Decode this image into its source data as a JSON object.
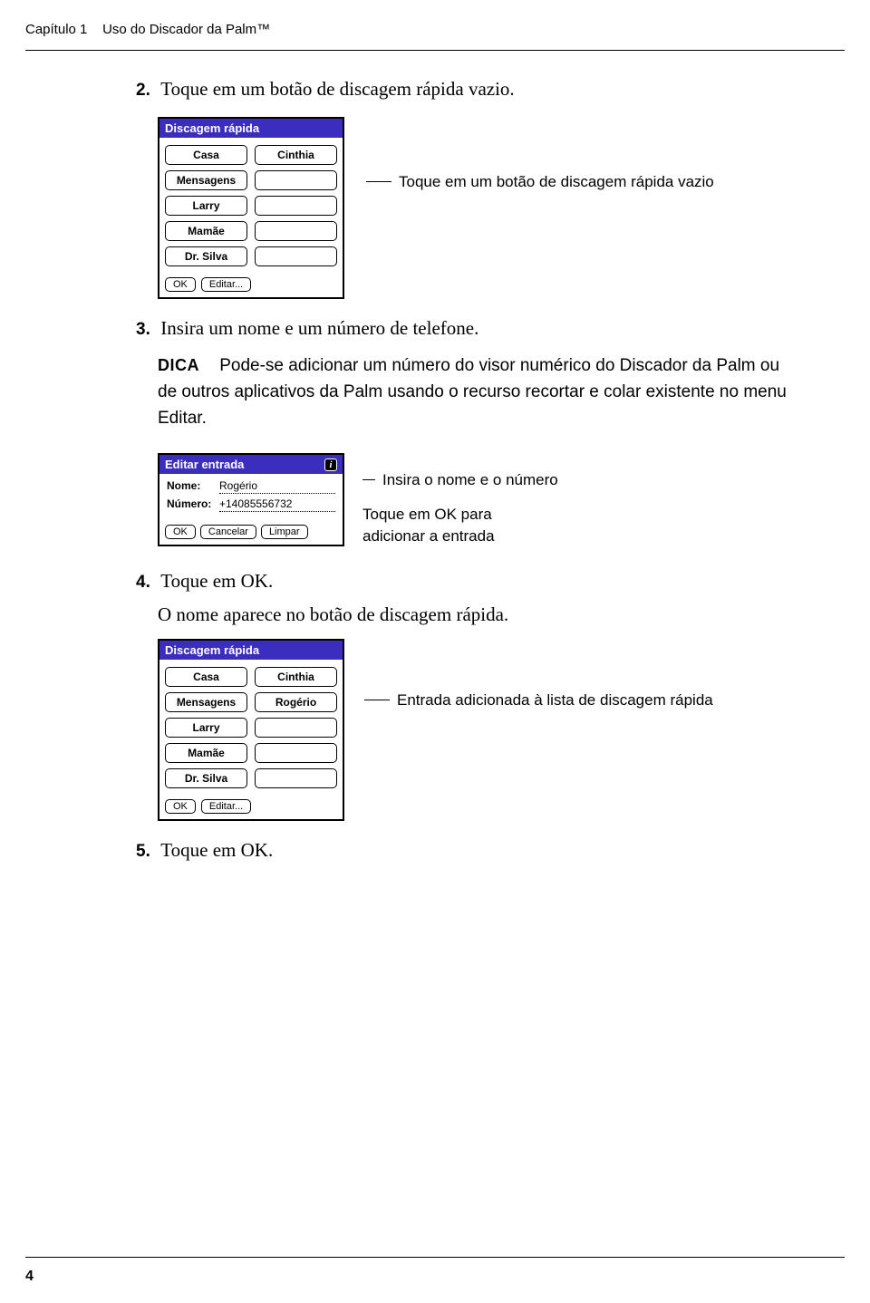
{
  "header": {
    "chapter_label": "Capítulo 1",
    "chapter_title": "Uso do Discador da Palm™"
  },
  "steps": {
    "s2_num": "2.",
    "s2_text": "Toque em um botão de discagem rápida vazio.",
    "s3_num": "3.",
    "s3_text": "Insira um nome e um número de telefone.",
    "s4_num": "4.",
    "s4_text": "Toque em OK.",
    "s4_body": "O nome aparece no botão de discagem rápida.",
    "s5_num": "5.",
    "s5_text": "Toque em OK."
  },
  "dica": {
    "label": "DICA",
    "text": "Pode-se adicionar um número do visor numérico do Discador da Palm ou de outros aplicativos da Palm usando o recurso recortar e colar existente no menu Editar."
  },
  "annotations": {
    "empty_button": "Toque em um botão de discagem rápida vazio",
    "insert_name_number": "Insira o nome e o número",
    "tap_ok_line1": "Toque em OK para",
    "tap_ok_line2": "adicionar a entrada",
    "entry_added": "Entrada adicionada à lista de discagem rápida"
  },
  "palm": {
    "speed_dial_title": "Discagem rápida",
    "ok": "OK",
    "edit": "Editar...",
    "buttons1": [
      "Casa",
      "Cinthia",
      "Mensagens",
      "",
      "Larry",
      "",
      "Mamãe",
      "",
      "Dr. Silva",
      ""
    ],
    "buttons3": [
      "Casa",
      "Cinthia",
      "Mensagens",
      "Rogério",
      "Larry",
      "",
      "Mamãe",
      "",
      "Dr. Silva",
      ""
    ]
  },
  "edit_dialog": {
    "title": "Editar entrada",
    "name_label": "Nome:",
    "name_value": "Rogério",
    "number_label": "Número:",
    "number_value": "+14085556732",
    "ok": "OK",
    "cancel": "Cancelar",
    "clear": "Limpar"
  },
  "page_number": "4"
}
